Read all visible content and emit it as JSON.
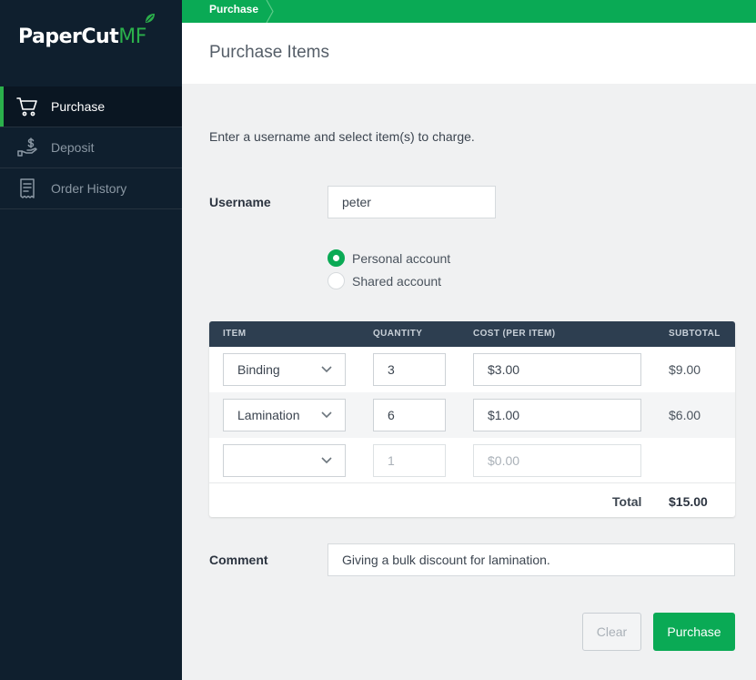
{
  "app": {
    "logo_text": "PaperCut",
    "logo_suffix": "MF",
    "brand_color": "#0aaa55"
  },
  "sidebar": {
    "items": [
      {
        "label": "Purchase",
        "icon": "cart-icon",
        "active": true
      },
      {
        "label": "Deposit",
        "icon": "deposit-hand-icon",
        "active": false
      },
      {
        "label": "Order History",
        "icon": "receipt-icon",
        "active": false
      }
    ]
  },
  "breadcrumb": {
    "current": "Purchase"
  },
  "page": {
    "title": "Purchase Items"
  },
  "form": {
    "intro": "Enter a username and select item(s) to charge.",
    "username_label": "Username",
    "username_value": "peter",
    "account_options": [
      {
        "label": "Personal account",
        "checked": true
      },
      {
        "label": "Shared account",
        "checked": false
      }
    ],
    "comment_label": "Comment",
    "comment_value": "Giving a bulk discount for lamination."
  },
  "table": {
    "headers": {
      "item": "ITEM",
      "quantity": "QUANTITY",
      "cost": "COST (PER ITEM)",
      "subtotal": "SUBTOTAL"
    },
    "rows": [
      {
        "item": "Binding",
        "quantity": "3",
        "cost": "$3.00",
        "subtotal": "$9.00"
      },
      {
        "item": "Lamination",
        "quantity": "6",
        "cost": "$1.00",
        "subtotal": "$6.00"
      },
      {
        "item": "",
        "quantity": "1",
        "cost": "$0.00",
        "subtotal": ""
      }
    ],
    "total_label": "Total",
    "total_value": "$15.00"
  },
  "buttons": {
    "clear": "Clear",
    "purchase": "Purchase"
  }
}
